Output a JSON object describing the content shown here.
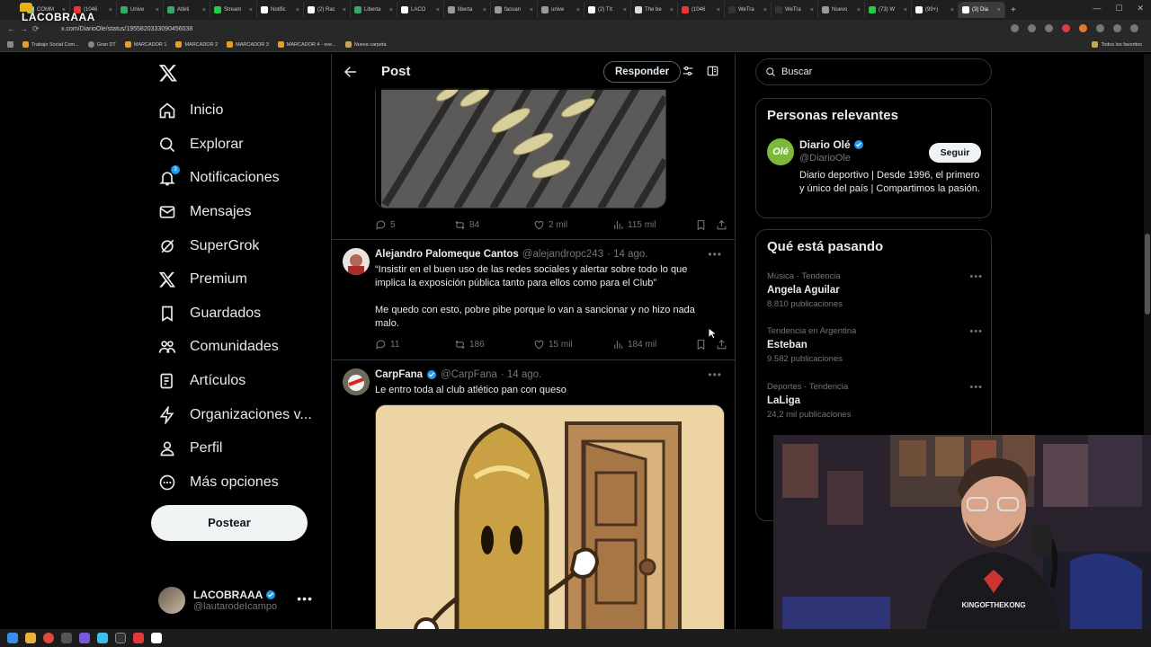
{
  "browser": {
    "tabs": [
      {
        "label": "COMM",
        "color": "#9c8"
      },
      {
        "label": "(1046",
        "color": "#e33"
      },
      {
        "label": "Unive",
        "color": "#3a6"
      },
      {
        "label": "Atléti",
        "color": "#3a6"
      },
      {
        "label": "Stream",
        "color": "#2c4"
      },
      {
        "label": "Notific",
        "color": "#fff"
      },
      {
        "label": "(2) Rac",
        "color": "#fff"
      },
      {
        "label": "Liberta",
        "color": "#3a6"
      },
      {
        "label": "LACO",
        "color": "#fff"
      },
      {
        "label": "liberta",
        "color": "#999"
      },
      {
        "label": "facuan",
        "color": "#999"
      },
      {
        "label": "unive",
        "color": "#999"
      },
      {
        "label": "(2) Tít",
        "color": "#fff"
      },
      {
        "label": "The be",
        "color": "#ddd"
      },
      {
        "label": "(1046",
        "color": "#e33"
      },
      {
        "label": "WeTra",
        "color": "#333"
      },
      {
        "label": "WeTra",
        "color": "#333"
      },
      {
        "label": "Nuevo",
        "color": "#999"
      },
      {
        "label": "(73) W",
        "color": "#2c4"
      },
      {
        "label": "(99+) ",
        "color": "#fff"
      },
      {
        "label": "(3) Dia",
        "color": "#fff"
      }
    ],
    "streamer_logo": "LACOBRAAA",
    "url": "x.com/DiarioOle/status/1955820333090456038",
    "bookmarks": [
      "Trabajo Social Com...",
      "Gran DT",
      "MARCADOR 1",
      "MARCADOR 2",
      "MARCADOR 3",
      "MARCADOR 4 - ove...",
      "Nueva carpeta"
    ],
    "bookmarks_all": "Todos los favoritos"
  },
  "nav": {
    "items": [
      {
        "label": "Inicio",
        "icon": "home-icon"
      },
      {
        "label": "Explorar",
        "icon": "search-icon"
      },
      {
        "label": "Notificaciones",
        "icon": "bell-icon"
      },
      {
        "label": "Mensajes",
        "icon": "mail-icon"
      },
      {
        "label": "SuperGrok",
        "icon": "grok-icon"
      },
      {
        "label": "Premium",
        "icon": "x-premium-icon"
      },
      {
        "label": "Guardados",
        "icon": "bookmark-icon"
      },
      {
        "label": "Comunidades",
        "icon": "communities-icon"
      },
      {
        "label": "Artículos",
        "icon": "articles-icon"
      },
      {
        "label": "Organizaciones v...",
        "icon": "lightning-icon"
      },
      {
        "label": "Perfil",
        "icon": "person-icon"
      },
      {
        "label": "Más opciones",
        "icon": "more-circle-icon"
      }
    ],
    "notif_badge": "3",
    "post_label": "Postear",
    "account": {
      "name": "LACOBRAAA",
      "handle": "@lautarodeIcampo"
    }
  },
  "header": {
    "title": "Post",
    "reply_label": "Responder"
  },
  "tweets": [
    {
      "stats": {
        "replies": "5",
        "retweets": "84",
        "likes": "2 mil",
        "views": "115 mil"
      }
    },
    {
      "name": "Alejandro Palomeque Cantos",
      "handle": "@alejandropc243",
      "time": "· 14 ago.",
      "text": "“Insistir en el buen uso de las redes sociales y alertar sobre todo lo que implica la exposición pública tanto para ellos como para el Club”",
      "text2": "Me quedo con esto, pobre pibe porque lo van a sancionar y no hizo nada malo.",
      "stats": {
        "replies": "11",
        "retweets": "186",
        "likes": "15 mil",
        "views": "184 mil"
      }
    },
    {
      "name": "CarpFana",
      "handle": "@CarpFana",
      "time": "· 14 ago.",
      "text": "Le entro toda al club atlético pan con queso"
    }
  ],
  "search": {
    "placeholder": "Buscar"
  },
  "relevant": {
    "title": "Personas relevantes",
    "name": "Diario Olé",
    "handle": "@DiarioOle",
    "avatar_text": "Olé",
    "bio": "Diario deportivo | Desde 1996, el primero y único del país | Compartimos la pasión.",
    "follow_label": "Seguir"
  },
  "trends": {
    "title": "Qué está pasando",
    "items": [
      {
        "category": "Música · Tendencia",
        "name": "Angela Aguilar",
        "count": "8.810 publicaciones"
      },
      {
        "category": "Tendencia en Argentina",
        "name": "Esteban",
        "count": "9.582 publicaciones"
      },
      {
        "category": "Deportes · Tendencia",
        "name": "LaLiga",
        "count": "24,2 mil publicaciones"
      }
    ]
  },
  "webcam": {
    "shirt_text": "KINGOFTHEKONG"
  },
  "colors": {
    "accent": "#1d9bf0",
    "background": "#000000",
    "border": "#2f3336",
    "muted": "#71767b"
  }
}
